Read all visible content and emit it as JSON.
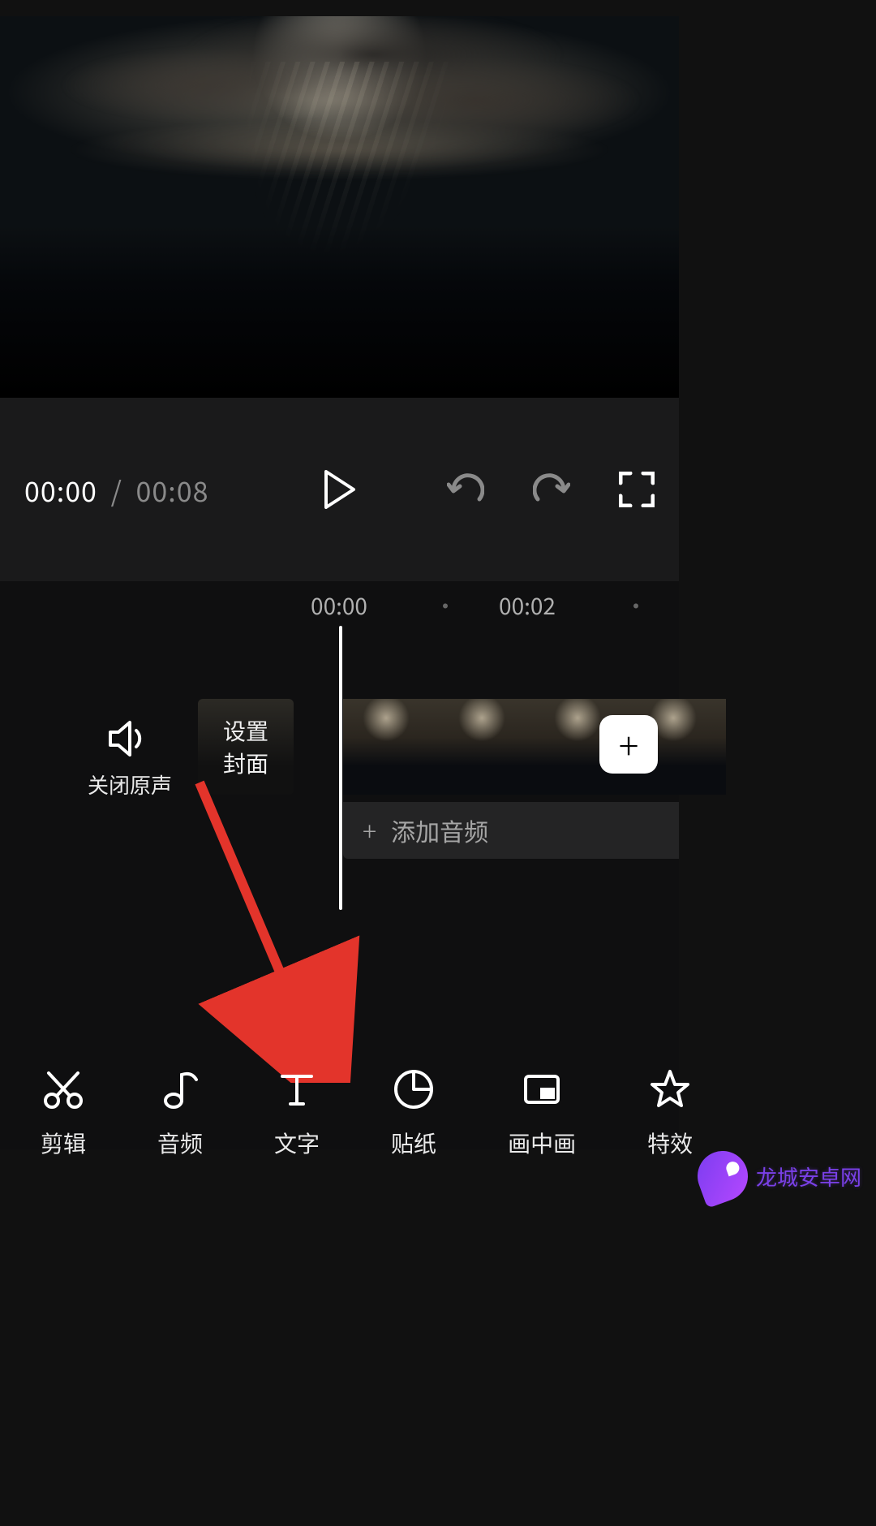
{
  "player": {
    "current_time": "00:00",
    "separator": "/",
    "duration": "00:08"
  },
  "ruler": {
    "tick1": "00:00",
    "tick2": "00:02",
    "dot": "·"
  },
  "mute": {
    "label": "关闭原声"
  },
  "cover": {
    "line1": "设置",
    "line2": "封面"
  },
  "add_clip": {
    "glyph": "+"
  },
  "add_audio": {
    "glyph": "+",
    "label": "添加音频"
  },
  "tools": [
    {
      "id": "edit",
      "label": "剪辑"
    },
    {
      "id": "audio",
      "label": "音频"
    },
    {
      "id": "text",
      "label": "文字"
    },
    {
      "id": "sticker",
      "label": "贴纸"
    },
    {
      "id": "pip",
      "label": "画中画"
    },
    {
      "id": "fx",
      "label": "特效"
    }
  ],
  "watermark": {
    "text": "龙城安卓网"
  },
  "icons": {
    "play": "play-icon",
    "undo": "undo-icon",
    "redo": "redo-icon",
    "fullscreen": "fullscreen-icon",
    "speaker": "speaker-icon",
    "scissors": "scissors-icon",
    "note": "music-note-icon",
    "text_t": "text-icon",
    "sticker": "sticker-icon",
    "pip": "picture-in-picture-icon",
    "star": "star-icon"
  },
  "colors": {
    "bg": "#111111",
    "panel": "#1a1a1b",
    "accent_arrow": "#e3342b",
    "watermark": "#7a40e8"
  }
}
